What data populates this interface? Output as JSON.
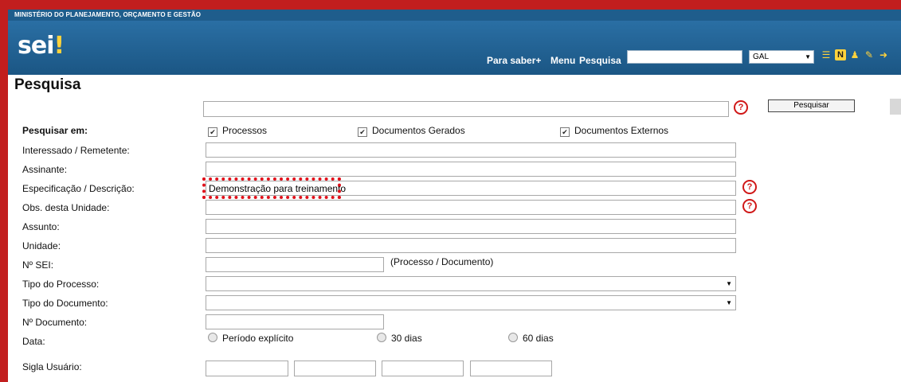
{
  "header": {
    "ministry": "MINISTÉRIO DO PLANEJAMENTO, ORÇAMENTO E GESTÃO",
    "logo_main": "sei",
    "logo_bang": "!",
    "nav": {
      "para_saber": "Para saber+",
      "menu": "Menu",
      "pesquisa": "Pesquisa"
    },
    "search_value": "",
    "unit_select": "GAL",
    "icons": [
      "list-icon",
      "notepad-icon",
      "user-icon",
      "tools-icon",
      "exit-icon"
    ]
  },
  "page": {
    "title": "Pesquisa",
    "search_button": "Pesquisar",
    "main_search_value": ""
  },
  "form": {
    "pesquisar_em": {
      "label": "Pesquisar em:",
      "options": [
        {
          "label": "Processos",
          "checked": true
        },
        {
          "label": "Documentos Gerados",
          "checked": true
        },
        {
          "label": "Documentos Externos",
          "checked": true
        }
      ]
    },
    "interessado": {
      "label": "Interessado / Remetente:",
      "value": ""
    },
    "assinante": {
      "label": "Assinante:",
      "value": ""
    },
    "especificacao": {
      "label": "Especificação / Descrição:",
      "value": "Demonstração para treinamento"
    },
    "obs": {
      "label": "Obs. desta Unidade:",
      "value": ""
    },
    "assunto": {
      "label": "Assunto:",
      "value": ""
    },
    "unidade": {
      "label": "Unidade:",
      "value": ""
    },
    "nsei": {
      "label": "Nº SEI:",
      "value": "",
      "hint": "(Processo / Documento)"
    },
    "tipo_processo": {
      "label": "Tipo do Processo:",
      "value": ""
    },
    "tipo_documento": {
      "label": "Tipo do Documento:",
      "value": ""
    },
    "ndocumento": {
      "label": "Nº Documento:",
      "value": ""
    },
    "data": {
      "label": "Data:",
      "options": [
        "Período explícito",
        "30 dias",
        "60 dias"
      ]
    },
    "sigla": {
      "label": "Sigla Usuário:",
      "values": [
        "",
        "",
        "",
        ""
      ]
    }
  },
  "colors": {
    "frame": "#c21e1e",
    "header": "#1f5d8c",
    "highlight": "#e0101a",
    "help": "#d01818"
  }
}
